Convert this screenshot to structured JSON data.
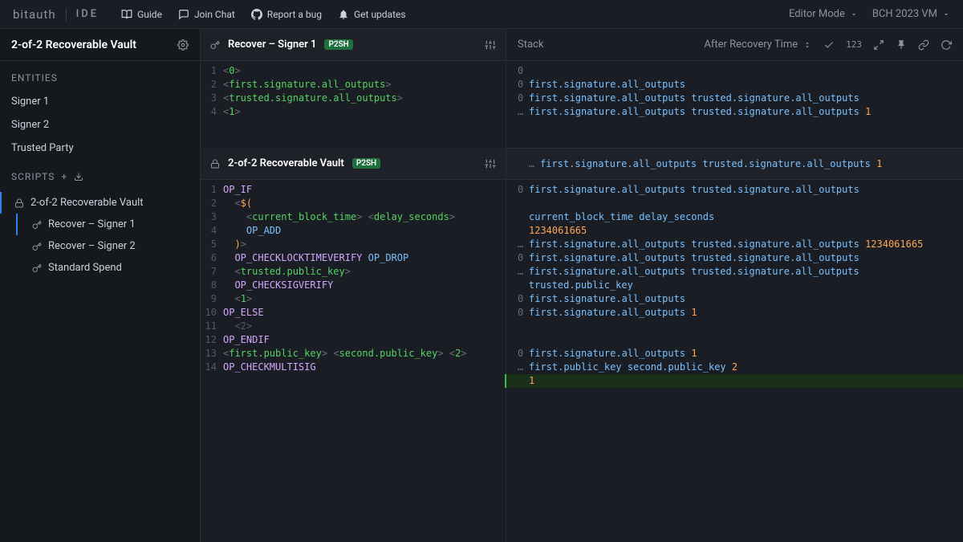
{
  "header": {
    "brand": "bitauth",
    "product": "IDE",
    "links": {
      "guide": "Guide",
      "chat": "Join Chat",
      "bug": "Report a bug",
      "updates": "Get updates"
    },
    "editorMode": "Editor Mode",
    "vm": "BCH 2023 VM"
  },
  "sidebar": {
    "title": "2-of-2 Recoverable Vault",
    "entitiesLabel": "ENTITIES",
    "entities": [
      "Signer 1",
      "Signer 2",
      "Trusted Party"
    ],
    "scriptsLabel": "SCRIPTS",
    "scripts": [
      {
        "name": "2-of-2 Recoverable Vault",
        "icon": "lock",
        "active": true,
        "children": [
          {
            "name": "Recover – Signer 1",
            "icon": "key",
            "active": true
          },
          {
            "name": "Recover – Signer 2",
            "icon": "key",
            "active": false
          },
          {
            "name": "Standard Spend",
            "icon": "key",
            "active": false
          }
        ]
      }
    ]
  },
  "pane1": {
    "title": "Recover – Signer 1",
    "badge": "P2SH",
    "lines": [
      {
        "n": 1,
        "tokens": [
          [
            "angle",
            "<"
          ],
          [
            "var",
            "0"
          ],
          [
            "angle",
            ">"
          ]
        ]
      },
      {
        "n": 2,
        "tokens": [
          [
            "angle",
            "<"
          ],
          [
            "var",
            "first.signature.all_outputs"
          ],
          [
            "angle",
            ">"
          ]
        ]
      },
      {
        "n": 3,
        "tokens": [
          [
            "angle",
            "<"
          ],
          [
            "var",
            "trusted.signature.all_outputs"
          ],
          [
            "angle",
            ">"
          ]
        ]
      },
      {
        "n": 4,
        "tokens": [
          [
            "angle",
            "<"
          ],
          [
            "var",
            "1"
          ],
          [
            "angle",
            ">"
          ]
        ]
      }
    ]
  },
  "pane2": {
    "title": "2-of-2 Recoverable Vault",
    "badge": "P2SH",
    "lines": [
      {
        "n": 1,
        "ind": 0,
        "tokens": [
          [
            "op",
            "OP_IF"
          ]
        ]
      },
      {
        "n": 2,
        "ind": 1,
        "tokens": [
          [
            "angle",
            "<"
          ],
          [
            "tpl",
            "$("
          ]
        ]
      },
      {
        "n": 3,
        "ind": 2,
        "tokens": [
          [
            "angle",
            "<"
          ],
          [
            "var",
            "current_block_time"
          ],
          [
            "angle",
            ">"
          ],
          [
            "plain",
            " "
          ],
          [
            "angle",
            "<"
          ],
          [
            "var",
            "delay_seconds"
          ],
          [
            "angle",
            ">"
          ]
        ]
      },
      {
        "n": 4,
        "ind": 2,
        "tokens": [
          [
            "opblue",
            "OP_ADD"
          ]
        ]
      },
      {
        "n": 5,
        "ind": 1,
        "tokens": [
          [
            "tpl",
            ")"
          ],
          [
            "angle",
            ">"
          ]
        ]
      },
      {
        "n": 6,
        "ind": 1,
        "tokens": [
          [
            "op",
            "OP_CHECKLOCKTIMEVERIFY"
          ],
          [
            "plain",
            " "
          ],
          [
            "opblue",
            "OP_DROP"
          ]
        ]
      },
      {
        "n": 7,
        "ind": 1,
        "tokens": [
          [
            "angle",
            "<"
          ],
          [
            "var",
            "trusted.public_key"
          ],
          [
            "angle",
            ">"
          ]
        ]
      },
      {
        "n": 8,
        "ind": 1,
        "tokens": [
          [
            "op",
            "OP_CHECKSIGVERIFY"
          ]
        ]
      },
      {
        "n": 9,
        "ind": 1,
        "tokens": [
          [
            "angle",
            "<"
          ],
          [
            "var",
            "1"
          ],
          [
            "angle",
            ">"
          ]
        ]
      },
      {
        "n": 10,
        "ind": 0,
        "tokens": [
          [
            "op",
            "OP_ELSE"
          ]
        ]
      },
      {
        "n": 11,
        "ind": 1,
        "tokens": [
          [
            "dim",
            "<2>"
          ]
        ]
      },
      {
        "n": 12,
        "ind": 0,
        "tokens": [
          [
            "op",
            "OP_ENDIF"
          ]
        ]
      },
      {
        "n": 13,
        "ind": 0,
        "tokens": [
          [
            "angle",
            "<"
          ],
          [
            "var",
            "first.public_key"
          ],
          [
            "angle",
            ">"
          ],
          [
            "plain",
            " "
          ],
          [
            "angle",
            "<"
          ],
          [
            "var",
            "second.public_key"
          ],
          [
            "angle",
            ">"
          ],
          [
            "plain",
            " "
          ],
          [
            "angle",
            "<"
          ],
          [
            "var",
            "2"
          ],
          [
            "angle",
            ">"
          ]
        ]
      },
      {
        "n": 14,
        "ind": 0,
        "tokens": [
          [
            "op",
            "OP_CHECKMULTISIG"
          ]
        ]
      }
    ]
  },
  "stack": {
    "label": "Stack",
    "scenario": "After Recovery Time",
    "numLabel": "123",
    "body1": [
      {
        "pfx": "0",
        "parts": []
      },
      {
        "pfx": "0",
        "parts": [
          [
            "var",
            "first.signature.all_outputs"
          ]
        ]
      },
      {
        "pfx": "0",
        "parts": [
          [
            "var",
            "first.signature.all_outputs"
          ],
          [
            "plain",
            " "
          ],
          [
            "var",
            "trusted.signature.all_outputs"
          ]
        ]
      },
      {
        "pfx": "…",
        "parts": [
          [
            "var",
            "first.signature.all_outputs"
          ],
          [
            "plain",
            " "
          ],
          [
            "var",
            "trusted.signature.all_outputs"
          ],
          [
            "plain",
            " "
          ],
          [
            "num",
            "1"
          ]
        ]
      }
    ],
    "sep": {
      "pfx": "…",
      "parts": [
        [
          "var",
          "first.signature.all_outputs"
        ],
        [
          "plain",
          " "
        ],
        [
          "var",
          "trusted.signature.all_outputs"
        ],
        [
          "plain",
          " "
        ],
        [
          "num",
          "1"
        ]
      ]
    },
    "body2": [
      {
        "pfx": "0",
        "parts": [
          [
            "var",
            "first.signature.all_outputs"
          ],
          [
            "plain",
            " "
          ],
          [
            "var",
            "trusted.signature.all_outputs"
          ]
        ]
      },
      {
        "gap": true
      },
      {
        "pfx": "",
        "parts": [
          [
            "var",
            "current_block_time"
          ],
          [
            "plain",
            " "
          ],
          [
            "var",
            "delay_seconds"
          ]
        ]
      },
      {
        "pfx": "",
        "parts": [
          [
            "num",
            "1234061665"
          ]
        ]
      },
      {
        "pfx": "…",
        "parts": [
          [
            "var",
            "first.signature.all_outputs"
          ],
          [
            "plain",
            " "
          ],
          [
            "var",
            "trusted.signature.all_outputs"
          ],
          [
            "plain",
            " "
          ],
          [
            "num",
            "1234061665"
          ]
        ]
      },
      {
        "pfx": "0",
        "parts": [
          [
            "var",
            "first.signature.all_outputs"
          ],
          [
            "plain",
            " "
          ],
          [
            "var",
            "trusted.signature.all_outputs"
          ]
        ]
      },
      {
        "pfx": "…",
        "parts": [
          [
            "var",
            "first.signature.all_outputs"
          ],
          [
            "plain",
            " "
          ],
          [
            "var",
            "trusted.signature.all_outputs"
          ],
          [
            "plain",
            " "
          ],
          [
            "var",
            "trusted.public_key"
          ]
        ]
      },
      {
        "pfx": "0",
        "parts": [
          [
            "var",
            "first.signature.all_outputs"
          ]
        ]
      },
      {
        "pfx": "0",
        "parts": [
          [
            "var",
            "first.signature.all_outputs"
          ],
          [
            "plain",
            " "
          ],
          [
            "num",
            "1"
          ]
        ]
      },
      {
        "gap": true
      },
      {
        "gap": true
      },
      {
        "pfx": "0",
        "parts": [
          [
            "var",
            "first.signature.all_outputs"
          ],
          [
            "plain",
            " "
          ],
          [
            "num",
            "1"
          ]
        ]
      },
      {
        "pfx": "…",
        "parts": [
          [
            "var",
            "first.public_key"
          ],
          [
            "plain",
            " "
          ],
          [
            "var",
            "second.public_key"
          ],
          [
            "plain",
            " "
          ],
          [
            "num",
            "2"
          ]
        ]
      },
      {
        "pfx": "",
        "hi": true,
        "parts": [
          [
            "num",
            "1"
          ]
        ]
      }
    ]
  }
}
